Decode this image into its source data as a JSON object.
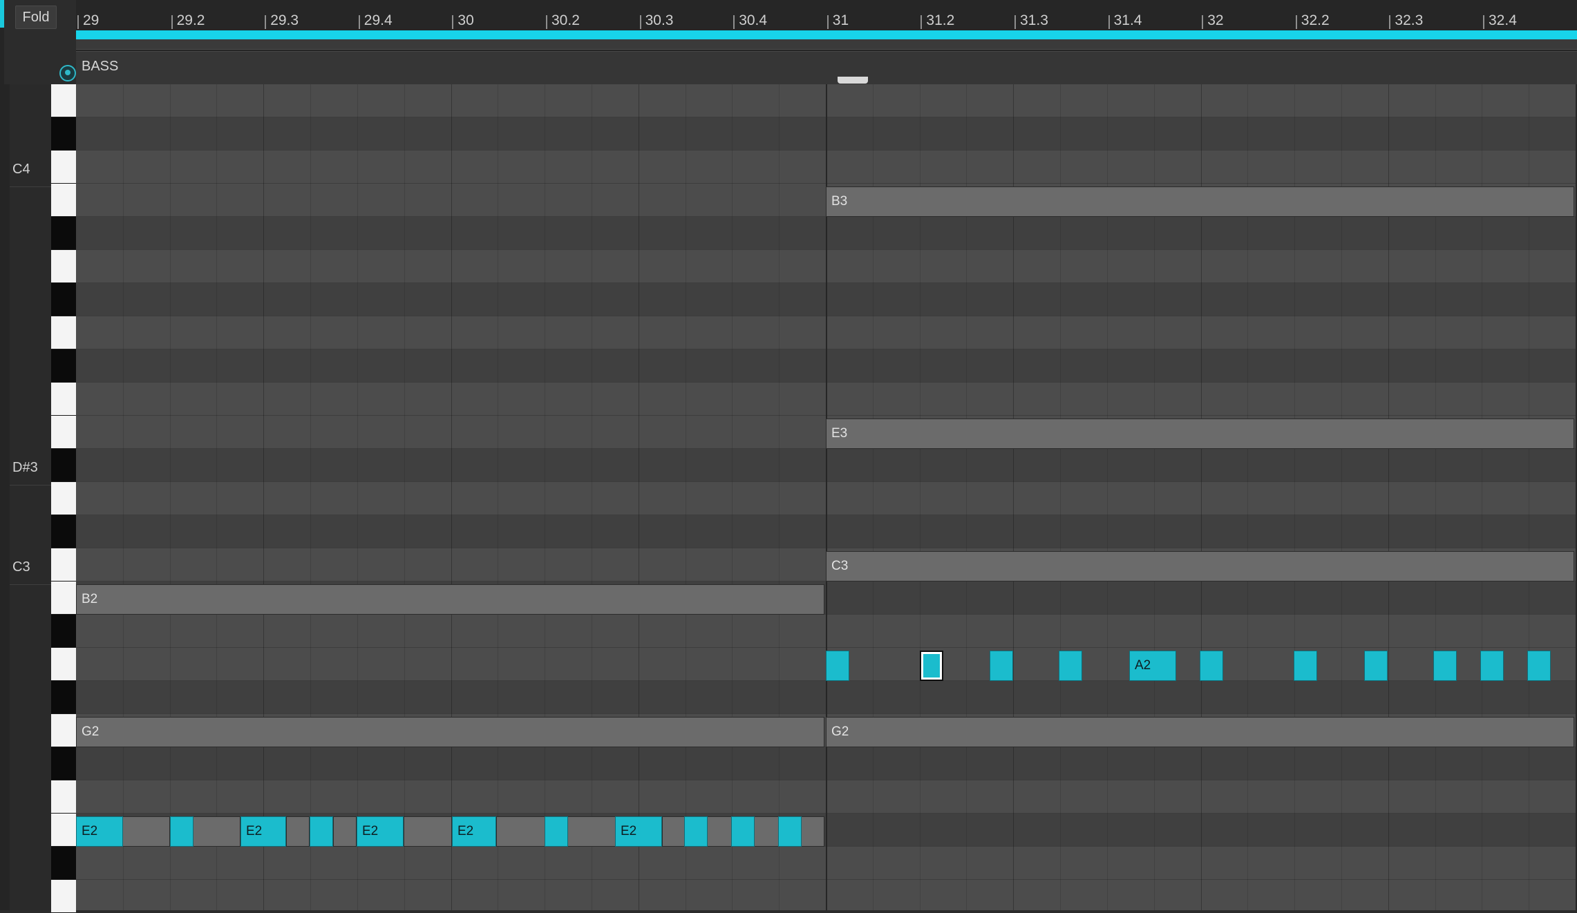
{
  "header": {
    "fold_label": "Fold",
    "clip_name": "BASS"
  },
  "ruler": {
    "labels": [
      "29",
      "29.2",
      "29.3",
      "29.4",
      "30",
      "30.2",
      "30.3",
      "30.4",
      "31",
      "31.2",
      "31.3",
      "31.4",
      "32",
      "32.2",
      "32.3",
      "32.4"
    ]
  },
  "pitch_labels": [
    "C4",
    "D#3",
    "C3"
  ],
  "notes": {
    "gray": [
      {
        "label": "B3"
      },
      {
        "label": "E3"
      },
      {
        "label": "C3"
      },
      {
        "label": "B2"
      },
      {
        "label": "G2"
      },
      {
        "label": "G2"
      }
    ],
    "a2_row": [
      {
        "label": ""
      },
      {
        "label": "",
        "selected": true
      },
      {
        "label": ""
      },
      {
        "label": ""
      },
      {
        "label": "A2"
      },
      {
        "label": ""
      },
      {
        "label": ""
      },
      {
        "label": ""
      },
      {
        "label": ""
      },
      {
        "label": ""
      },
      {
        "label": ""
      }
    ],
    "e2_row_gray": [
      {
        "label": ""
      },
      {
        "label": ""
      },
      {
        "label": ""
      },
      {
        "label": ""
      },
      {
        "label": ""
      },
      {
        "label": ""
      },
      {
        "label": ""
      }
    ],
    "e2_row": [
      {
        "label": "E2"
      },
      {
        "label": ""
      },
      {
        "label": "E2"
      },
      {
        "label": ""
      },
      {
        "label": "E2"
      },
      {
        "label": "E2"
      },
      {
        "label": ""
      },
      {
        "label": "E2"
      },
      {
        "label": ""
      },
      {
        "label": ""
      },
      {
        "label": ""
      }
    ]
  },
  "colors": {
    "accent": "#18d4ea",
    "note_cyan": "#1bbccd",
    "note_gray": "#6b6b6b"
  }
}
